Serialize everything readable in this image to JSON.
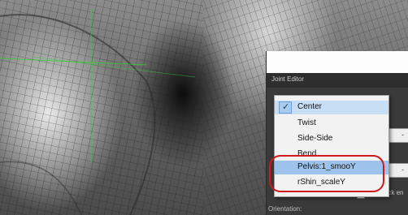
{
  "joint_editor": {
    "title": "Joint Editor",
    "autolock_label": "Auto-lock en",
    "orientation_label": "Orientation:",
    "field_value": "-"
  },
  "dropdown": {
    "items": [
      {
        "label": "Center",
        "checked": true
      },
      {
        "label": "Twist"
      },
      {
        "label": "Side-Side"
      },
      {
        "label": "Bend"
      },
      {
        "label": "Pelvis:1_smooY"
      },
      {
        "label": "rShin_scaleY"
      }
    ]
  },
  "colors": {
    "highlight_ring": "#d01a1a",
    "crosshair": "#2fd12f",
    "menu_selected": "#c8def5"
  }
}
